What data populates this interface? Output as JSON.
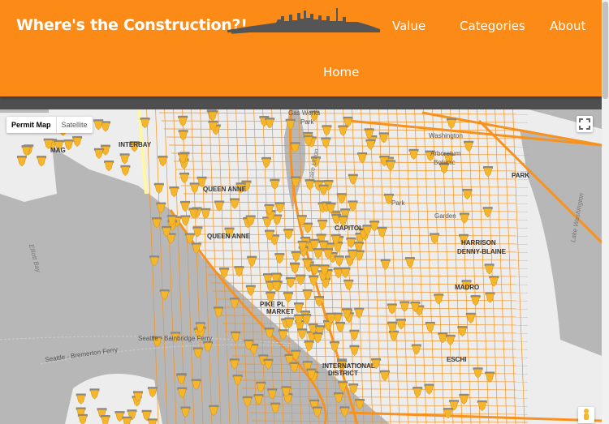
{
  "nav": {
    "brand": "Where's the Construction?!",
    "links": [
      "Value",
      "Categories",
      "About"
    ],
    "home": "Home"
  },
  "map": {
    "type_buttons": [
      "Permit Map",
      "Satellite"
    ],
    "labels": [
      "Gas Works",
      "Park",
      "Washington",
      "Arboretum",
      "Botanic",
      "INTERBAY",
      "MAG",
      "QUEEN ANNE",
      "QUEEN ANNE",
      "PARK",
      "Lake Union",
      "Lake Washington",
      "Elliott Bay",
      "HARRISON",
      "DENNY-BLAINE",
      "MADRO",
      "PIKE PL",
      "MARKET",
      "Seattle - Bainbridge Ferry",
      "Seattle - Bremerton Ferry",
      "INTERNATIONAL",
      "DISTRICT",
      "ESCHI",
      "CAPITOL",
      "Park",
      "Garden"
    ]
  },
  "colors": {
    "navbar": "#fc8a16",
    "road": "#f7921e",
    "land": "#ededed",
    "water": "#b7b7b7",
    "marker": "#f6b62c"
  },
  "icons": [
    "skyline-logo",
    "fullscreen-icon",
    "pegman-icon",
    "construction-marker-icon"
  ]
}
